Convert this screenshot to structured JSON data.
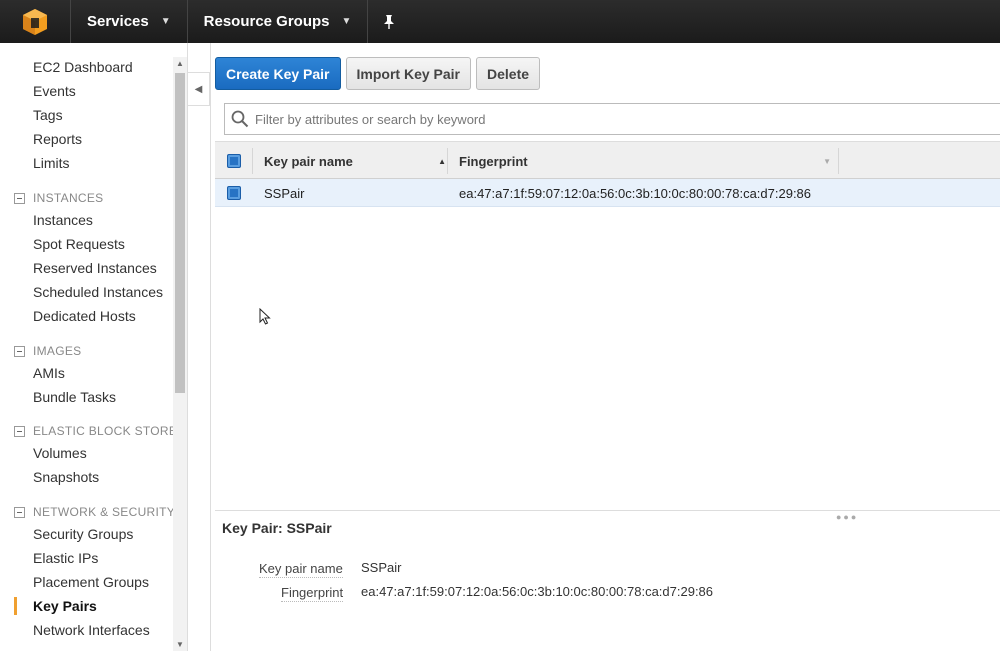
{
  "topbar": {
    "services_label": "Services",
    "resource_groups_label": "Resource Groups"
  },
  "sidebar": {
    "items_top": [
      "EC2 Dashboard",
      "Events",
      "Tags",
      "Reports",
      "Limits"
    ],
    "sections": [
      {
        "title": "INSTANCES",
        "items": [
          "Instances",
          "Spot Requests",
          "Reserved Instances",
          "Scheduled Instances",
          "Dedicated Hosts"
        ]
      },
      {
        "title": "IMAGES",
        "items": [
          "AMIs",
          "Bundle Tasks"
        ]
      },
      {
        "title": "ELASTIC BLOCK STORE",
        "items": [
          "Volumes",
          "Snapshots"
        ]
      },
      {
        "title": "NETWORK & SECURITY",
        "items": [
          "Security Groups",
          "Elastic IPs",
          "Placement Groups",
          "Key Pairs",
          "Network Interfaces"
        ]
      }
    ],
    "active_item": "Key Pairs"
  },
  "toolbar": {
    "create_label": "Create Key Pair",
    "import_label": "Import Key Pair",
    "delete_label": "Delete"
  },
  "search": {
    "placeholder": "Filter by attributes or search by keyword",
    "value": ""
  },
  "table": {
    "columns": [
      "Key pair name",
      "Fingerprint"
    ],
    "rows": [
      {
        "name": "SSPair",
        "fingerprint": "ea:47:a7:1f:59:07:12:0a:56:0c:3b:10:0c:80:00:78:ca:d7:29:86",
        "selected": true
      }
    ]
  },
  "detail": {
    "title": "Key Pair: SSPair",
    "fields": [
      {
        "label": "Key pair name",
        "value": "SSPair"
      },
      {
        "label": "Fingerprint",
        "value": "ea:47:a7:1f:59:07:12:0a:56:0c:3b:10:0c:80:00:78:ca:d7:29:86"
      }
    ]
  },
  "colors": {
    "topbar": "#1b1b1b",
    "primary_button": "#1a6bc0",
    "selected_row": "#e8f1fb",
    "active_marker": "#f0a030"
  }
}
